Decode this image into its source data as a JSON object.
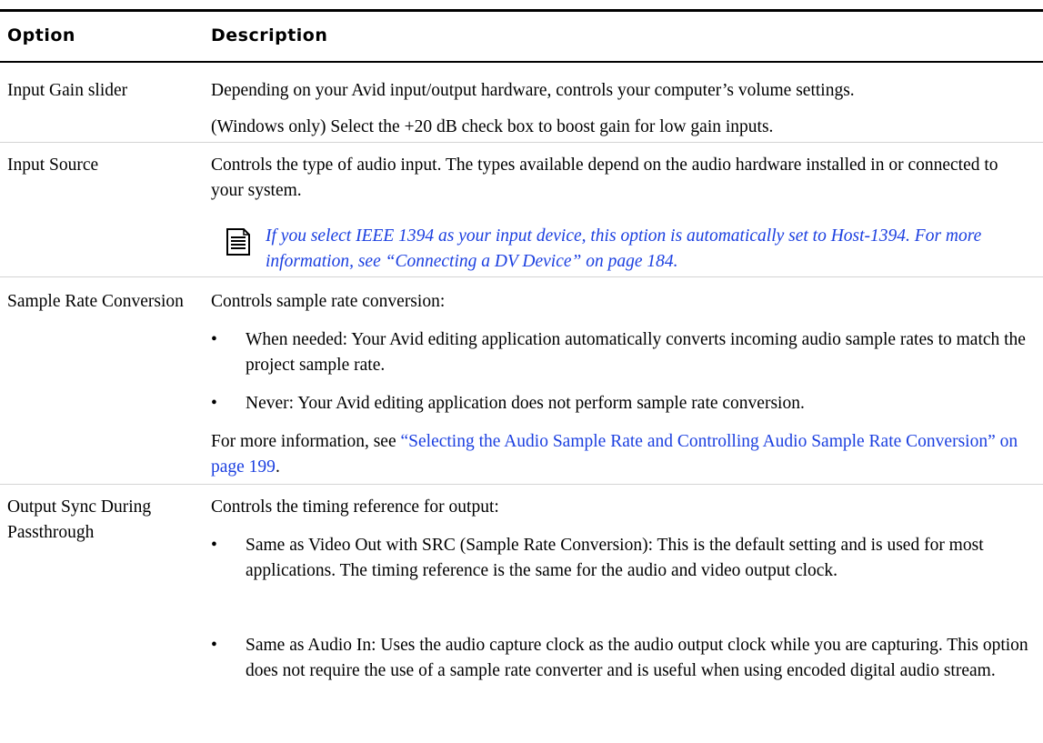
{
  "header": {
    "option": "Option",
    "description": "Description"
  },
  "rows": [
    {
      "option": "Input Gain slider",
      "desc1": "Depending on your Avid input/output hardware, controls your computer’s volume settings.",
      "desc2": "(Windows only) Select the +20 dB check box to boost gain for low gain inputs."
    },
    {
      "option": "Input Source",
      "desc1": "Controls the type of audio input. The types available depend on the audio hardware installed in or connected to your system.",
      "note": "If you select IEEE 1394 as your input device, this option is automatically set to Host-1394. For more information, see “Connecting a DV Device” on page 184.",
      "note_icon": "note-icon"
    },
    {
      "option": "Sample Rate Conversion",
      "desc1": "Controls sample rate conversion:",
      "bullets": [
        "When needed: Your Avid editing application automatically converts incoming audio sample rates to match the project sample rate.",
        "Never: Your Avid editing application does not perform sample rate conversion."
      ],
      "more_prefix": "For more information, see ",
      "more_link": "“Selecting the Audio Sample Rate and Controlling Audio Sample Rate Conversion” on page 199",
      "more_suffix": "."
    },
    {
      "option": "Output Sync During Passthrough",
      "desc1": "Controls the timing reference for output:",
      "bullets": [
        "Same as Video Out with SRC (Sample Rate Conversion): This is the default setting and is used for most applications. The timing reference is the same for the audio and video output clock.",
        "Same as Audio In: Uses the audio capture clock as the audio output clock while you are capturing. This option does not require the use of a sample rate converter and is useful when using encoded digital audio stream."
      ]
    }
  ],
  "bullet_char": "•",
  "colors": {
    "link": "#1b3fe0",
    "rule": "#000000",
    "row_rule": "#d4d4d4"
  }
}
